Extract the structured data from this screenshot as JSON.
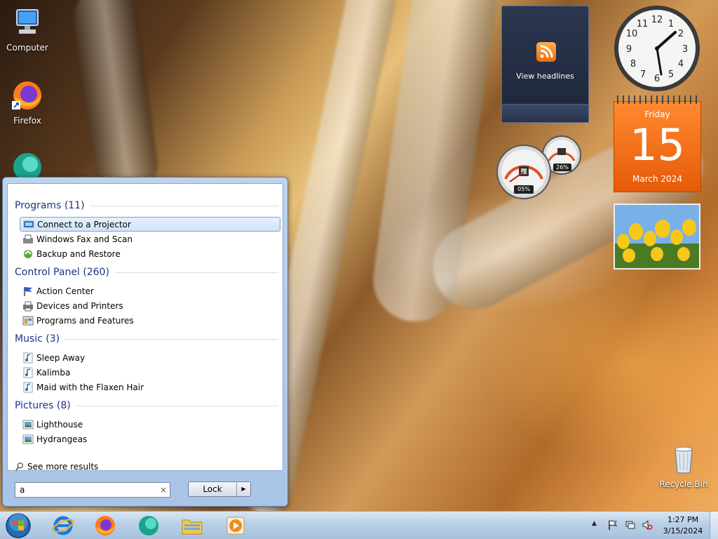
{
  "desktop": {
    "icons": [
      {
        "label": "Computer",
        "icon": "computer-icon"
      },
      {
        "label": "Firefox",
        "icon": "firefox-icon"
      },
      {
        "label": "Recycle Bin",
        "icon": "recycle-bin-icon"
      }
    ]
  },
  "gadgets": {
    "feed": {
      "label": "View headlines",
      "icon": "rss-icon"
    },
    "calendar": {
      "weekday": "Friday",
      "day": "15",
      "month_year": "March 2024"
    },
    "cpu_meter": {
      "cpu": "05%",
      "memory": "26%"
    }
  },
  "start_menu": {
    "groups": [
      {
        "title": "Programs (11)",
        "items": [
          {
            "label": "Connect to a Projector",
            "icon": "projector-icon",
            "selected": true
          },
          {
            "label": "Windows Fax and Scan",
            "icon": "fax-icon"
          },
          {
            "label": "Backup and Restore",
            "icon": "backup-icon"
          }
        ]
      },
      {
        "title": "Control Panel (260)",
        "items": [
          {
            "label": "Action Center",
            "icon": "flag-icon"
          },
          {
            "label": "Devices and Printers",
            "icon": "printer-icon"
          },
          {
            "label": "Programs and Features",
            "icon": "programs-icon"
          }
        ]
      },
      {
        "title": "Music (3)",
        "items": [
          {
            "label": "Sleep Away",
            "icon": "music-file-icon"
          },
          {
            "label": "Kalimba",
            "icon": "music-file-icon"
          },
          {
            "label": "Maid with the Flaxen Hair",
            "icon": "music-file-icon"
          }
        ]
      },
      {
        "title": "Pictures (8)",
        "items": [
          {
            "label": "Lighthouse",
            "icon": "picture-file-icon"
          },
          {
            "label": "Hydrangeas",
            "icon": "picture-file-icon"
          }
        ]
      }
    ],
    "see_more": "See more results",
    "search_value": "a",
    "clear_symbol": "×",
    "lock_label": "Lock",
    "lock_arrow": "▶"
  },
  "taskbar": {
    "pinned": [
      "internet-explorer-icon",
      "firefox-icon",
      "edge-icon",
      "file-explorer-icon",
      "media-player-icon"
    ],
    "tray": [
      "show-hidden-icons-icon",
      "action-center-flag-icon",
      "network-icon",
      "volume-muted-icon"
    ],
    "show_hidden": "▲",
    "time": "1:27 PM",
    "date": "3/15/2024"
  }
}
